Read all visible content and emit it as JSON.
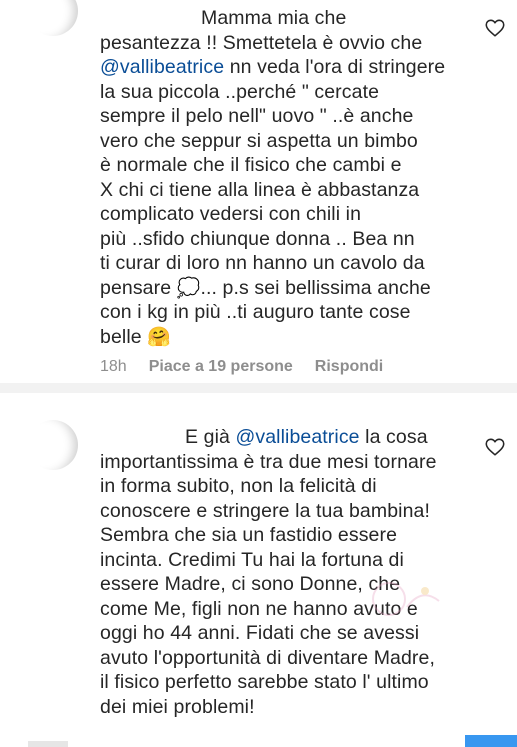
{
  "comments": [
    {
      "user": "",
      "text_prefix": "Mamma mia che\npesantezza !! Smettetela è ovvio che\n",
      "mention": "@vallibeatrice",
      "text_suffix": " nn veda l'ora di stringere\nla sua piccola ..perché \" cercate\nsempre il pelo nell\" uovo \" ..è anche\nvero che seppur si aspetta un bimbo\nè normale che il fisico che cambi e\nX chi ci tiene alla linea è abbastanza\ncomplicato vedersi con chili in\npiù ..sfido chiunque donna .. Bea nn\nti curar di loro nn hanno un cavolo da\npensare ",
      "emoji_1": "💭",
      "text_suffix_2": "... p.s sei bellissima anche\ncon i kg in più ..ti auguro tante cose\nbelle ",
      "emoji_2": "🤗",
      "time": "18h",
      "likes_label": "Piace a 19 persone",
      "reply_label": "Rispondi"
    },
    {
      "user": "",
      "text_prefix": "E già ",
      "mention": "@vallibeatrice",
      "text_suffix": " la cosa\nimportantissima è tra due mesi tornare\nin forma subito, non la felicità di\nconoscere e stringere la tua bambina!\nSembra che sia un fastidio essere\nincinta. Credimi Tu hai la fortuna di\nessere Madre, ci sono Donne, che\ncome Me, figli non ne hanno avuto e\noggi ho 44 anni. Fidati che se avessi\navuto l'opportunità di diventare Madre,\nil fisico perfetto sarebbe stato l' ultimo\ndei miei problemi!"
    }
  ],
  "icons": {
    "like": "heart-outline-icon"
  },
  "colors": {
    "mention": "#0a4d96",
    "meta": "#8e8e8e",
    "text": "#262626"
  }
}
